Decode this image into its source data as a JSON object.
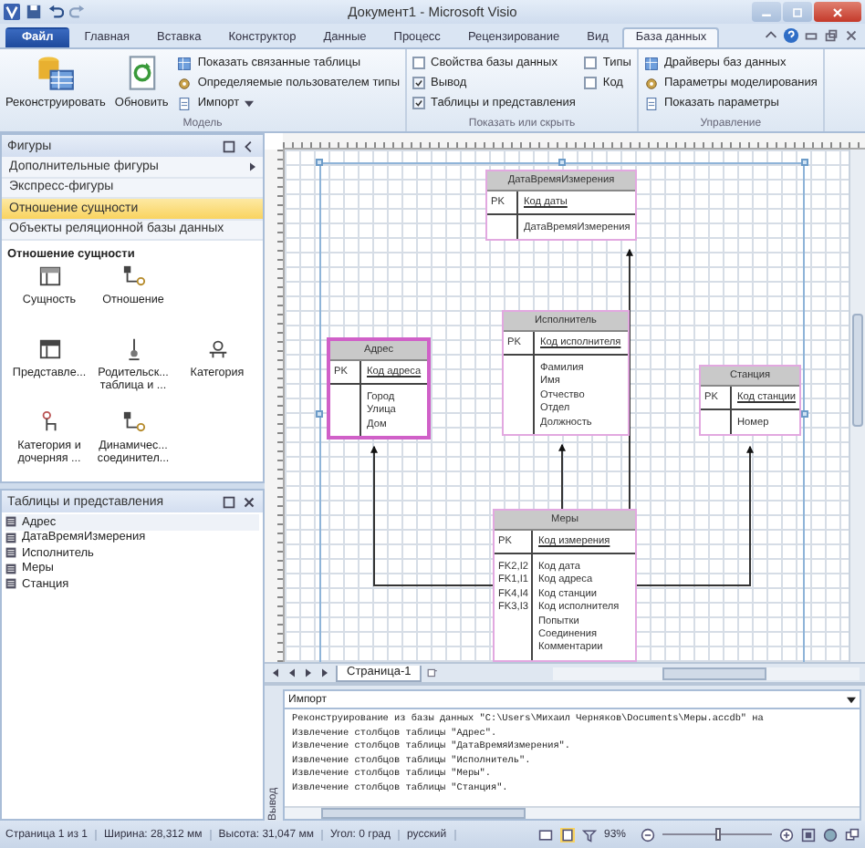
{
  "window": {
    "title": "Документ1 - Microsoft Visio"
  },
  "ribbon_tabs": [
    {
      "label": "Файл",
      "kind": "file",
      "selected": false
    },
    {
      "label": "Главная",
      "kind": "tab",
      "selected": false
    },
    {
      "label": "Вставка",
      "kind": "tab",
      "selected": false
    },
    {
      "label": "Конструктор",
      "kind": "tab",
      "selected": false
    },
    {
      "label": "Данные",
      "kind": "tab",
      "selected": false
    },
    {
      "label": "Процесс",
      "kind": "tab",
      "selected": false
    },
    {
      "label": "Рецензирование",
      "kind": "tab",
      "selected": false
    },
    {
      "label": "Вид",
      "kind": "tab",
      "selected": false
    },
    {
      "label": "База данных",
      "kind": "tab",
      "selected": true
    }
  ],
  "ribbon_groups": [
    {
      "label": "Модель",
      "large_buttons": [
        "Реконструировать",
        "Обновить"
      ],
      "small_buttons": [
        {
          "label": "Показать связанные таблицы",
          "dropdown": false
        },
        {
          "label": "Определяемые пользователем типы",
          "dropdown": false
        },
        {
          "label": "Импорт",
          "dropdown": true
        }
      ]
    },
    {
      "label": "Показать или скрыть",
      "checkbox_columns": [
        [
          {
            "label": "Свойства базы данных",
            "checked": false
          },
          {
            "label": "Вывод",
            "checked": true
          },
          {
            "label": "Таблицы и представления",
            "checked": true
          }
        ],
        [
          {
            "label": "Типы",
            "checked": false
          },
          {
            "label": "Код",
            "checked": false
          }
        ]
      ]
    },
    {
      "label": "Управление",
      "small_buttons": [
        {
          "label": "Драйверы баз данных",
          "dropdown": false
        },
        {
          "label": "Параметры моделирования",
          "dropdown": false
        },
        {
          "label": "Показать параметры",
          "dropdown": false
        }
      ]
    }
  ],
  "shapes_panel": {
    "title": "Фигуры",
    "stencils": [
      {
        "label": "Дополнительные фигуры",
        "submenu": true,
        "selected": false
      },
      {
        "label": "Экспресс-фигуры",
        "submenu": false,
        "selected": false
      },
      {
        "label": "Отношение сущности",
        "submenu": false,
        "selected": true
      },
      {
        "label": "Объекты реляционной базы данных",
        "submenu": false,
        "selected": false
      }
    ],
    "section_title": "Отношение сущности",
    "shapes": [
      {
        "kind": "entity",
        "lines": [
          "Сущность"
        ]
      },
      {
        "kind": "relationship",
        "lines": [
          "Отношение"
        ]
      },
      {
        "kind": "gap"
      },
      {
        "kind": "view",
        "lines": [
          "Представле..."
        ]
      },
      {
        "kind": "parent",
        "lines": [
          "Родительск...",
          "таблица и ..."
        ]
      },
      {
        "kind": "category",
        "lines": [
          "Категория"
        ]
      },
      {
        "kind": "child",
        "lines": [
          "Категория и",
          "дочерняя ..."
        ]
      },
      {
        "kind": "dynamic",
        "lines": [
          "Динамичес...",
          "соединител..."
        ]
      }
    ]
  },
  "tables_panel": {
    "title": "Таблицы и представления",
    "items": [
      {
        "label": "Адрес",
        "selected": true
      },
      {
        "label": "ДатаВремяИзмерения",
        "selected": false
      },
      {
        "label": "Исполнитель",
        "selected": false
      },
      {
        "label": "Меры",
        "selected": false
      },
      {
        "label": "Станция",
        "selected": false
      }
    ]
  },
  "diagram": {
    "entities": [
      {
        "name": "ДатаВремяИзмерения",
        "selected": false,
        "pk_label": "PK",
        "pk_field": "Код даты",
        "fields": [
          {
            "name": "ДатаВремяИзмерения"
          }
        ]
      },
      {
        "name": "Адрес",
        "selected": true,
        "pk_label": "PK",
        "pk_field": "Код адреса",
        "fields": [
          {
            "name": "Город"
          },
          {
            "name": "Улица"
          },
          {
            "name": "Дом"
          }
        ]
      },
      {
        "name": "Исполнитель",
        "selected": false,
        "pk_label": "PK",
        "pk_field": "Код исполнителя",
        "fields": [
          {
            "name": "Фамилия"
          },
          {
            "name": "Имя"
          },
          {
            "name": "Отчество"
          },
          {
            "name": "Отдел"
          },
          {
            "name": "Должность"
          }
        ]
      },
      {
        "name": "Станция",
        "selected": false,
        "pk_label": "PK",
        "pk_field": "Код станции",
        "fields": [
          {
            "name": "Номер"
          }
        ]
      },
      {
        "name": "Меры",
        "selected": false,
        "pk_label": "PK",
        "pk_field": "Код измерения",
        "fields": [
          {
            "key": "FK2,I2",
            "name": "Код дата"
          },
          {
            "key": "FK1,I1",
            "name": "Код адреса"
          },
          {
            "key": "FK4,I4",
            "name": "Код станции"
          },
          {
            "key": "FK3,I3",
            "name": "Код исполнителя"
          },
          {
            "name": "Попытки"
          },
          {
            "name": "Соединения"
          },
          {
            "name": "Комментарии"
          }
        ]
      }
    ]
  },
  "page_tabs": [
    {
      "label": "Страница-1",
      "selected": true
    }
  ],
  "output": {
    "title": "Вывод",
    "source": "Импорт",
    "lines": [
      "Реконструирование из базы данных \"C:\\Users\\Михаил Черняков\\Documents\\Меры.accdb\" на",
      "Извлечение столбцов таблицы \"Адрес\".",
      "Извлечение столбцов таблицы \"ДатаВремяИзмерения\".",
      "Извлечение столбцов таблицы \"Исполнитель\".",
      "Извлечение столбцов таблицы \"Меры\".",
      "Извлечение столбцов таблицы \"Станция\"."
    ]
  },
  "status_bar": {
    "page": "Страница 1 из 1",
    "width": "Ширина: 28,312 мм",
    "height": "Высота: 31,047 мм",
    "angle": "Угол: 0 град",
    "language": "русский",
    "zoom": "93%",
    "zoom_slider": {
      "level": 0.5
    }
  }
}
